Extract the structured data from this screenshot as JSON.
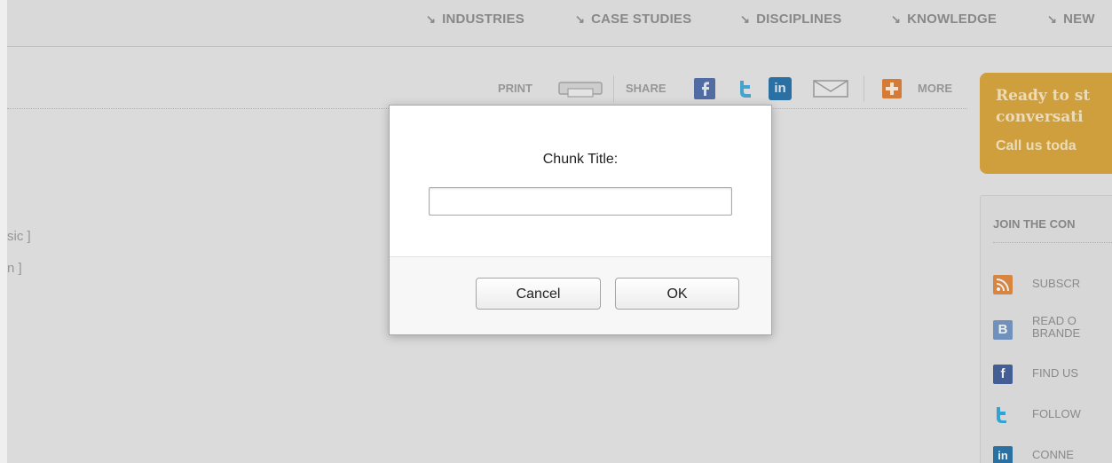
{
  "topnav": {
    "items": [
      {
        "label": "INDUSTRIES"
      },
      {
        "label": "CASE STUDIES"
      },
      {
        "label": "DISCIPLINES"
      },
      {
        "label": "KNOWLEDGE"
      },
      {
        "label": "NEW"
      }
    ],
    "arrow_glyph": "↘"
  },
  "toolbar": {
    "print_label": "PRINT",
    "share_label": "SHARE",
    "more_label": "MORE",
    "icons": [
      "printer-icon",
      "facebook-icon",
      "twitter-icon",
      "linkedin-icon",
      "email-icon",
      "more-plus-icon"
    ]
  },
  "left_fragments": [
    "sic ]",
    "n ]"
  ],
  "cta": {
    "line1": "Ready to st",
    "line2": "conversati",
    "line3": "Call us toda",
    "color": "#dba435"
  },
  "join": {
    "title": "JOIN THE CON",
    "items": [
      {
        "label": "SUBSCR",
        "icon": "rss-icon",
        "color": "#e3883a"
      },
      {
        "label_line1": "READ O",
        "label_line2": "BRANDE",
        "icon": "blog-icon",
        "color": "#6e94c4"
      },
      {
        "label": "FIND US",
        "icon": "facebook-icon",
        "color": "#3b5a98"
      },
      {
        "label": "FOLLOW",
        "icon": "twitter-icon",
        "color": "#2aa9e0"
      },
      {
        "label": "CONNE",
        "icon": "linkedin-icon",
        "color": "#1f6fa8"
      }
    ]
  },
  "dialog": {
    "title": "Chunk Title:",
    "input_value": "",
    "cancel_label": "Cancel",
    "ok_label": "OK"
  }
}
